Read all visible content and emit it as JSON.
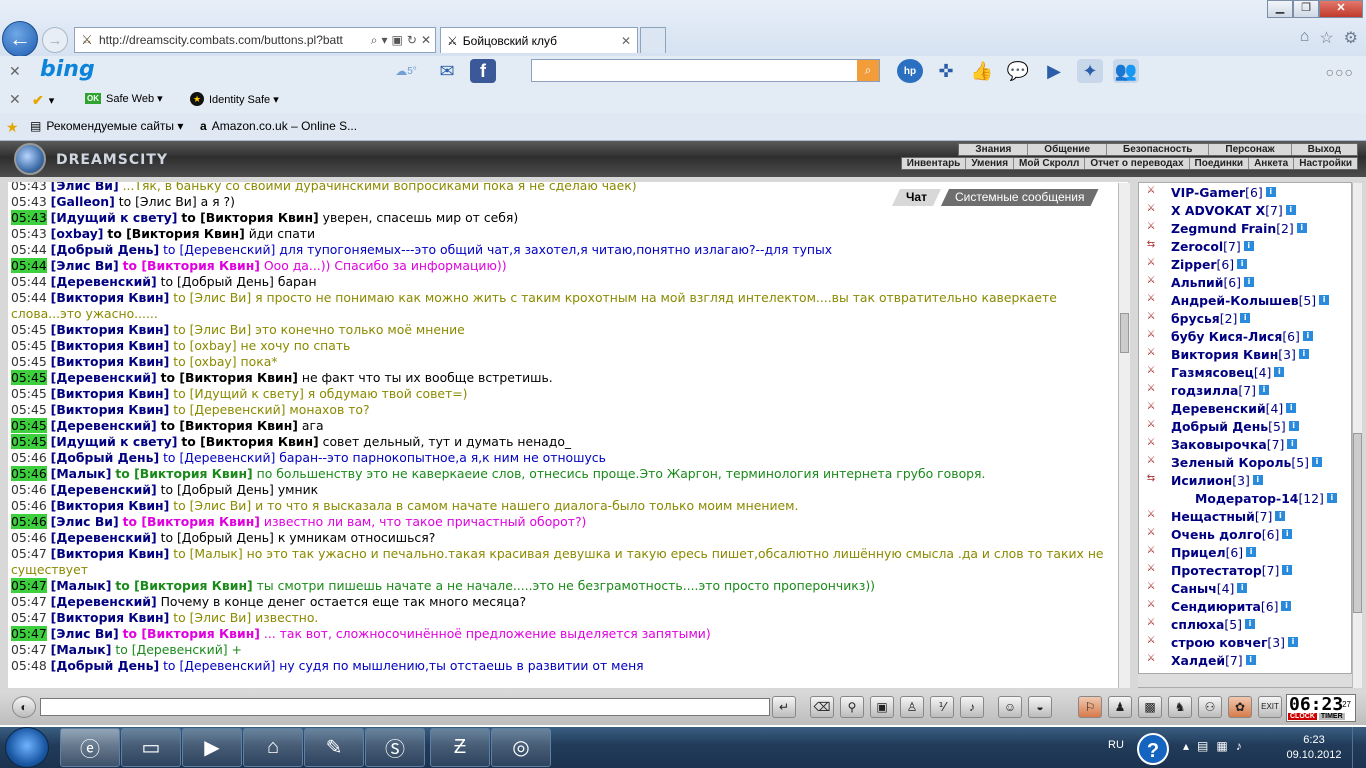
{
  "browser": {
    "url": "http://dreamscity.combats.com/buttons.pl?batt",
    "tab_title": "Бойцовский клуб",
    "bing_logo": "bing",
    "weather_temp": "5°",
    "safe_web": "Safe Web ▾",
    "identity_safe": "Identity Safe ▾",
    "ok": "OK",
    "fav_recommended": "Рекомендуемые сайты ▾",
    "fav_amazon": "Amazon.co.uk – Online S...",
    "more": "○○○"
  },
  "game": {
    "logo_text": "DREAMSCITY",
    "menu_top": [
      "Знания",
      "Общение",
      "Безопасность",
      "Персонаж",
      "Выход"
    ],
    "menu_bottom": [
      "Инвентарь",
      "Умения",
      "Мой Скролл",
      "Отчет о переводах",
      "Поединки",
      "Анкета",
      "Настройки"
    ],
    "chat_tabs": [
      "Чат",
      "Системные сообщения"
    ]
  },
  "chat": [
    {
      "time": "05:43",
      "hl": false,
      "nick": "[Элис Ви]",
      "to": "",
      "msg": "...Тяк, в баньку со своими дурачинскими вопросиками пока я не сделаю чаёк)",
      "color": "olive"
    },
    {
      "time": "05:43",
      "hl": false,
      "nick": "[Galleon]",
      "to": "",
      "msg": "to [Элис Ви] а я ?)",
      "color": "dark"
    },
    {
      "time": "05:43",
      "hl": true,
      "nick": "[Идущий к свету]",
      "to": "to [Виктория Квин]",
      "msg": "уверен, спасешь мир от себя)",
      "color": "dark"
    },
    {
      "time": "05:43",
      "hl": false,
      "nick": "[oxbay]",
      "to": "to [Виктория Квин]",
      "msg": "йди спати",
      "color": "dark"
    },
    {
      "time": "05:44",
      "hl": false,
      "nick": "[Добрый День]",
      "to": "",
      "msg": "to [Деревенский] для тупогоняемых---это общий чат,я захотел,я читаю,понятно излагаю?--для тупых",
      "color": "blue"
    },
    {
      "time": "05:44",
      "hl": true,
      "nick": "[Элис Ви]",
      "to": "to [Виктория Квин]",
      "msg": "Ооо да...)) Спасибо за информацию))",
      "color": "mag"
    },
    {
      "time": "05:44",
      "hl": false,
      "nick": "[Деревенский]",
      "to": "",
      "msg": "to [Добрый День] баран",
      "color": "dark"
    },
    {
      "time": "05:44",
      "hl": false,
      "nick": "[Виктория Квин]",
      "to": "",
      "msg": "to [Элис Ви] я просто не понимаю как можно жить с таким крохотным на мой взгляд интелектом....вы так отвратительно каверкаете слова...это ужасно......",
      "color": "olive"
    },
    {
      "time": "05:45",
      "hl": false,
      "nick": "[Виктория Квин]",
      "to": "",
      "msg": "to [Элис Ви] это конечно только моё мнение",
      "color": "olive"
    },
    {
      "time": "05:45",
      "hl": false,
      "nick": "[Виктория Квин]",
      "to": "",
      "msg": "to [oxbay] не хочу по спать",
      "color": "olive"
    },
    {
      "time": "05:45",
      "hl": false,
      "nick": "[Виктория Квин]",
      "to": "",
      "msg": "to [oxbay] пока*",
      "color": "olive"
    },
    {
      "time": "05:45",
      "hl": true,
      "nick": "[Деревенский]",
      "to": "to [Виктория Квин]",
      "msg": "не факт что ты их вообще встретишь.",
      "color": "dark"
    },
    {
      "time": "05:45",
      "hl": false,
      "nick": "[Виктория Квин]",
      "to": "",
      "msg": "to [Идущий к свету] я обдумаю твой совет=)",
      "color": "olive"
    },
    {
      "time": "05:45",
      "hl": false,
      "nick": "[Виктория Квин]",
      "to": "",
      "msg": "to [Деревенский] монахов то?",
      "color": "olive"
    },
    {
      "time": "05:45",
      "hl": true,
      "nick": "[Деревенский]",
      "to": "to [Виктория Квин]",
      "msg": "ага",
      "color": "dark"
    },
    {
      "time": "05:45",
      "hl": true,
      "nick": "[Идущий к свету]",
      "to": "to [Виктория Квин]",
      "msg": "совет дельный, тут и думать ненадо_",
      "color": "dark"
    },
    {
      "time": "05:46",
      "hl": false,
      "nick": "[Добрый День]",
      "to": "",
      "msg": "to [Деревенский] баран--это парнокопытное,а я,к ним не отношусь",
      "color": "blue"
    },
    {
      "time": "05:46",
      "hl": true,
      "nick": "[Малык]",
      "to": "to [Виктория Квин]",
      "msg": "по большенству это не каверкаеие слов, отнесись проще.Это Жаргон, терминология интернета грубо говоря.",
      "color": "green"
    },
    {
      "time": "05:46",
      "hl": false,
      "nick": "[Деревенский]",
      "to": "",
      "msg": "to [Добрый День] умник",
      "color": "dark"
    },
    {
      "time": "05:46",
      "hl": false,
      "nick": "[Виктория Квин]",
      "to": "",
      "msg": "to [Элис Ви] и то что я высказала в самом начате нашего диалога-было только моим мнением.",
      "color": "olive"
    },
    {
      "time": "05:46",
      "hl": true,
      "nick": "[Элис Ви]",
      "to": "to [Виктория Квин]",
      "msg": "известно ли вам, что такое причастный оборот?)",
      "color": "mag"
    },
    {
      "time": "05:46",
      "hl": false,
      "nick": "[Деревенский]",
      "to": "",
      "msg": "to [Добрый День] к умникам относишься?",
      "color": "dark"
    },
    {
      "time": "05:47",
      "hl": false,
      "nick": "[Виктория Квин]",
      "to": "",
      "msg": "to [Малык] но это так ужасно и печально.такая красивая девушка и такую ересь пишет,обсалютно лишённую смысла .да и слов то таких не существует",
      "color": "olive"
    },
    {
      "time": "05:47",
      "hl": true,
      "nick": "[Малык]",
      "to": "to [Виктория Квин]",
      "msg": "ты смотри пишешь начате а не начале.....это не безграмотность....это просто проперончикз))",
      "color": "green"
    },
    {
      "time": "05:47",
      "hl": false,
      "nick": "[Деревенский]",
      "to": "",
      "msg": "Почему в конце денег остается еще так много месяца?",
      "color": "dark"
    },
    {
      "time": "05:47",
      "hl": false,
      "nick": "[Виктория Квин]",
      "to": "",
      "msg": "to [Элис Ви] известно.",
      "color": "olive"
    },
    {
      "time": "05:47",
      "hl": true,
      "nick": "[Элис Ви]",
      "to": "to [Виктория Квин]",
      "msg": "... так вот, сложносочинённоё предложение выделяется запятыми)",
      "color": "mag"
    },
    {
      "time": "05:47",
      "hl": false,
      "nick": "[Малык]",
      "to": "",
      "msg": "to [Деревенский] +",
      "color": "green"
    },
    {
      "time": "05:48",
      "hl": false,
      "nick": "[Добрый День]",
      "to": "",
      "msg": "to [Деревенский] ну судя по мышлению,ты отстаешь в развитии от меня",
      "color": "blue"
    }
  ],
  "users": [
    {
      "name": "VIP-Gamer",
      "level": "[6]"
    },
    {
      "name": "X ADVOKAT X",
      "level": "[7]"
    },
    {
      "name": "Zegmund Frain",
      "level": "[2]"
    },
    {
      "name": "Zerocol",
      "level": "[7]"
    },
    {
      "name": "Zipper",
      "level": "[6]"
    },
    {
      "name": "Альпий",
      "level": "[6]"
    },
    {
      "name": "Андрей-Колышев",
      "level": "[5]"
    },
    {
      "name": "брусья",
      "level": "[2]"
    },
    {
      "name": "бубу Кися-Лися",
      "level": "[6]"
    },
    {
      "name": "Виктория Квин",
      "level": "[3]"
    },
    {
      "name": "Газмясовец",
      "level": "[4]"
    },
    {
      "name": "годзилла",
      "level": "[7]"
    },
    {
      "name": "Деревенский",
      "level": "[4]"
    },
    {
      "name": "Добрый День",
      "level": "[5]"
    },
    {
      "name": "Заковырочка",
      "level": "[7]"
    },
    {
      "name": "Зеленый Король",
      "level": "[5]"
    },
    {
      "name": "Исилион",
      "level": "[3]"
    },
    {
      "name": "Модератор-14",
      "level": "[12]"
    },
    {
      "name": "Нещастный",
      "level": "[7]"
    },
    {
      "name": "Очень долго",
      "level": "[6]"
    },
    {
      "name": "Прицел",
      "level": "[6]"
    },
    {
      "name": "Протестатор",
      "level": "[7]"
    },
    {
      "name": "Саныч",
      "level": "[4]"
    },
    {
      "name": "Сендиюрита",
      "level": "[6]"
    },
    {
      "name": "сплюха",
      "level": "[5]"
    },
    {
      "name": "строю ковчег",
      "level": "[3]"
    },
    {
      "name": "Халдей",
      "level": "[7]"
    }
  ],
  "clock": {
    "time": "06:23",
    "sec": "27",
    "clock_lbl": "CLOCK",
    "timer_lbl": "TIMER"
  },
  "tray": {
    "lang": "RU",
    "time": "6:23",
    "date": "09.10.2012"
  }
}
